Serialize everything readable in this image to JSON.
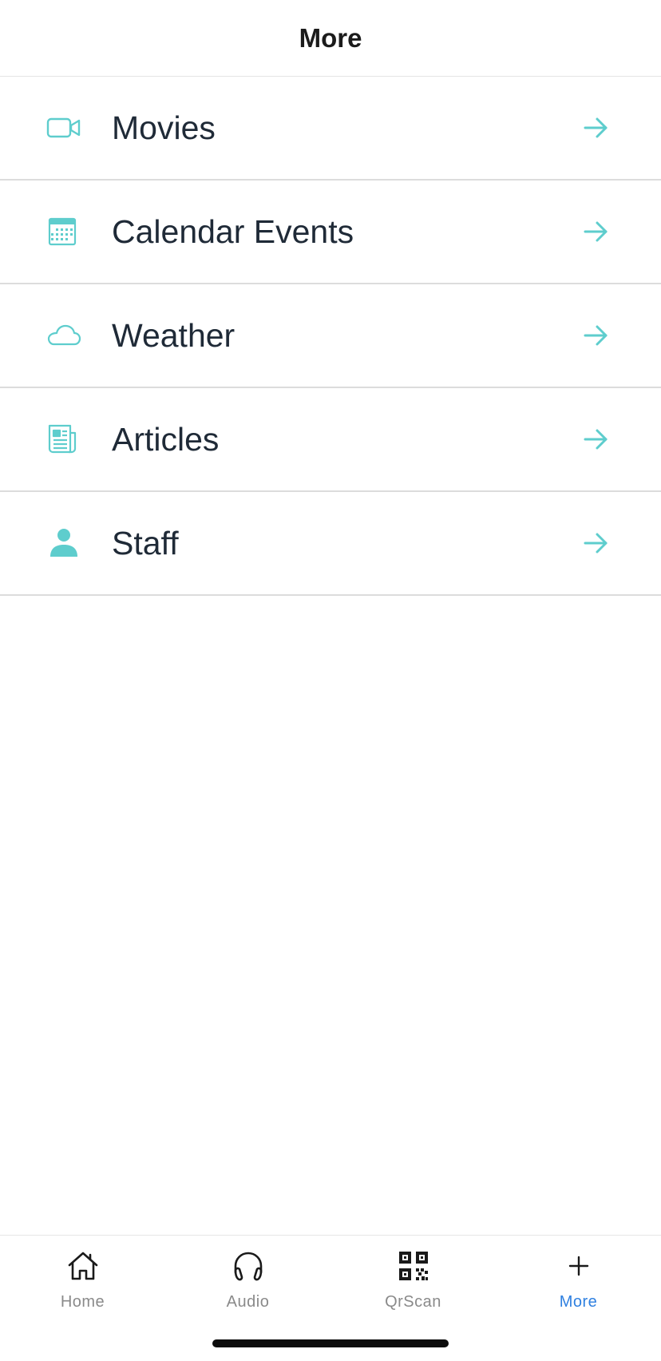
{
  "header": {
    "title": "More"
  },
  "accent_color": "#5ecdcd",
  "menu": [
    {
      "label": "Movies",
      "icon": "video-camera-icon"
    },
    {
      "label": "Calendar Events",
      "icon": "calendar-icon"
    },
    {
      "label": "Weather",
      "icon": "cloud-icon"
    },
    {
      "label": "Articles",
      "icon": "newspaper-icon"
    },
    {
      "label": "Staff",
      "icon": "person-icon"
    }
  ],
  "tabbar": {
    "active_color": "#2f80e0",
    "inactive_color": "#8a8a8a",
    "tabs": [
      {
        "label": "Home",
        "icon": "home-icon"
      },
      {
        "label": "Audio",
        "icon": "headphones-icon"
      },
      {
        "label": "QrScan",
        "icon": "qr-code-icon"
      },
      {
        "label": "More",
        "icon": "plus-icon",
        "active": true
      }
    ]
  }
}
